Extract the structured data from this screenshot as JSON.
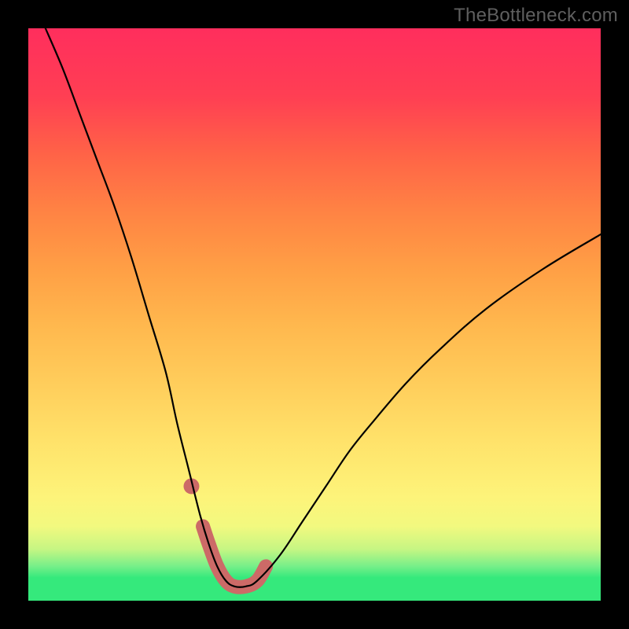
{
  "watermark": "TheBottleneck.com",
  "chart_data": {
    "type": "line",
    "title": "",
    "xlabel": "",
    "ylabel": "",
    "xlim": [
      0,
      100
    ],
    "ylim": [
      0,
      100
    ],
    "grid": false,
    "legend": false,
    "axes_visible": false,
    "background_gradient": {
      "orientation": "vertical",
      "stops": [
        {
          "pos": 0.0,
          "color": "#ff2e5d"
        },
        {
          "pos": 0.5,
          "color": "#ffe26a"
        },
        {
          "pos": 0.93,
          "color": "#76ef89"
        },
        {
          "pos": 1.0,
          "color": "#35e97c"
        }
      ]
    },
    "series": [
      {
        "name": "bottleneck-curve",
        "color": "#000000",
        "x": [
          3,
          6,
          9,
          12,
          15,
          18,
          21,
          24,
          26,
          28,
          30,
          31.5,
          33,
          34.5,
          36,
          38,
          40,
          44,
          48,
          52,
          56,
          60,
          66,
          72,
          80,
          90,
          100
        ],
        "y": [
          100,
          93,
          85,
          77,
          69,
          60,
          50,
          40,
          31,
          23,
          15,
          10,
          6,
          3.5,
          2.5,
          2.5,
          3.5,
          8,
          14,
          20,
          26,
          31,
          38,
          44,
          51,
          58,
          64
        ]
      }
    ],
    "highlight": {
      "name": "minimum-region",
      "color": "#cc6a67",
      "style": "thick-stroke",
      "x": [
        30.5,
        31.5,
        33,
        34.5,
        36,
        38,
        40,
        41.5
      ],
      "y": [
        13,
        10,
        6,
        3.5,
        2.5,
        2.5,
        3.5,
        6
      ]
    },
    "marker": {
      "name": "left-dot",
      "color": "#cc6a67",
      "x": 28.5,
      "y": 20
    }
  }
}
